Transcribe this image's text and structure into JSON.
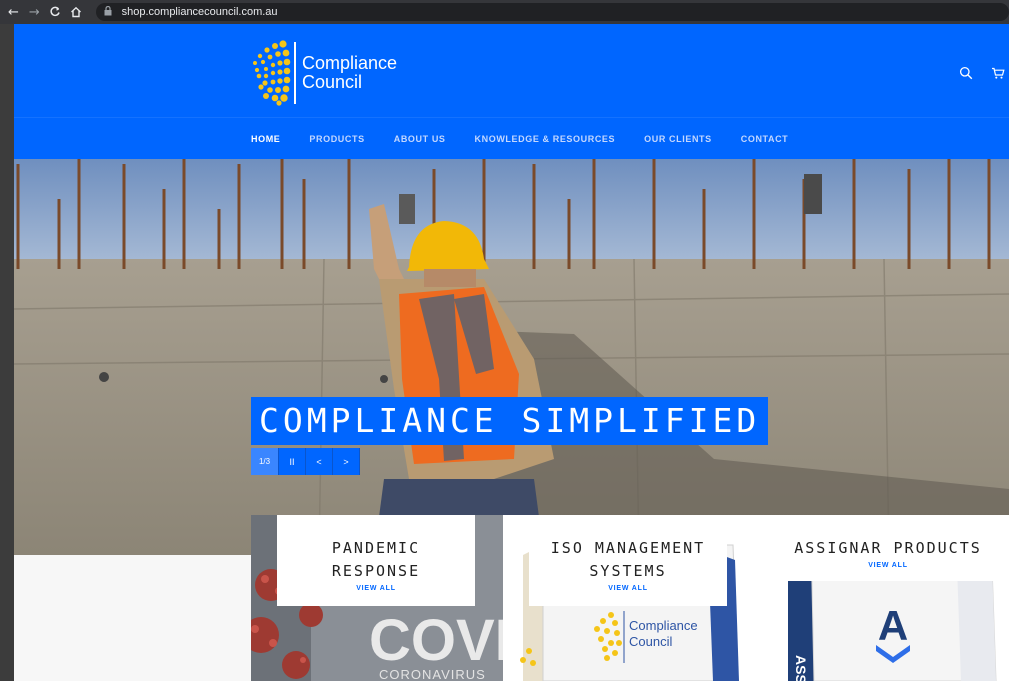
{
  "browser": {
    "url": "shop.compliancecouncil.com.au",
    "back_icon": "←",
    "forward_icon": "→",
    "reload_icon": "C",
    "home_icon": "⌂"
  },
  "header": {
    "logo_line1": "Compliance",
    "logo_line2": "Council",
    "brand_color": "#0066ff",
    "accent_color": "#f5c518"
  },
  "nav": {
    "items": [
      "HOME",
      "PRODUCTS",
      "ABOUT US",
      "KNOWLEDGE & RESOURCES",
      "OUR CLIENTS",
      "CONTACT"
    ],
    "active": "HOME"
  },
  "hero": {
    "title": "COMPLIANCE SIMPLIFIED",
    "counter": "1/3",
    "pause": "II",
    "prev": "<",
    "next": ">"
  },
  "collections": [
    {
      "title_line1": "PANDEMIC",
      "title_line2": "RESPONSE",
      "view": "VIEW ALL",
      "image_text1": "COVI",
      "image_text2": "CORONAVIRUS"
    },
    {
      "title_line1": "ISO MANAGEMENT",
      "title_line2": "SYSTEMS",
      "view": "VIEW ALL",
      "image_text1": "Compliance",
      "image_text2": "Council"
    },
    {
      "title_line1": "ASSIGNAR PRODUCTS",
      "title_line2": "",
      "view": "VIEW ALL",
      "image_text1": "A",
      "image_text2": "ASS"
    }
  ]
}
